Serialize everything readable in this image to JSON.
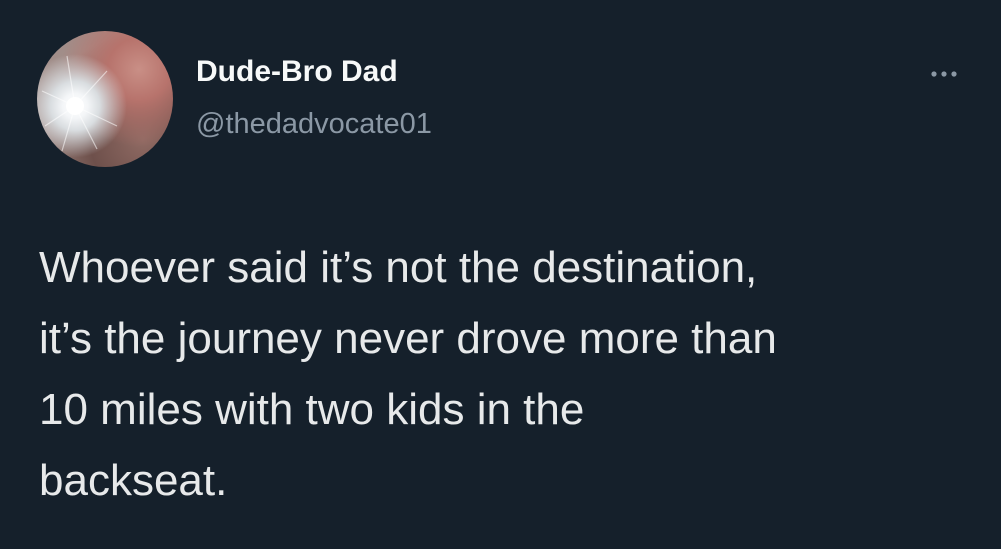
{
  "tweet": {
    "author": {
      "display_name": "Dude-Bro Dad",
      "handle": "@thedadvocate01"
    },
    "more_icon": "more-horizontal-icon",
    "text": "Whoever said it’s not the destination,\nit’s the journey never drove more than\n10 miles with two kids in the\nbackseat."
  },
  "colors": {
    "background": "#15202b",
    "primary_text": "#e7e9ea",
    "secondary_text": "#8b98a5"
  }
}
